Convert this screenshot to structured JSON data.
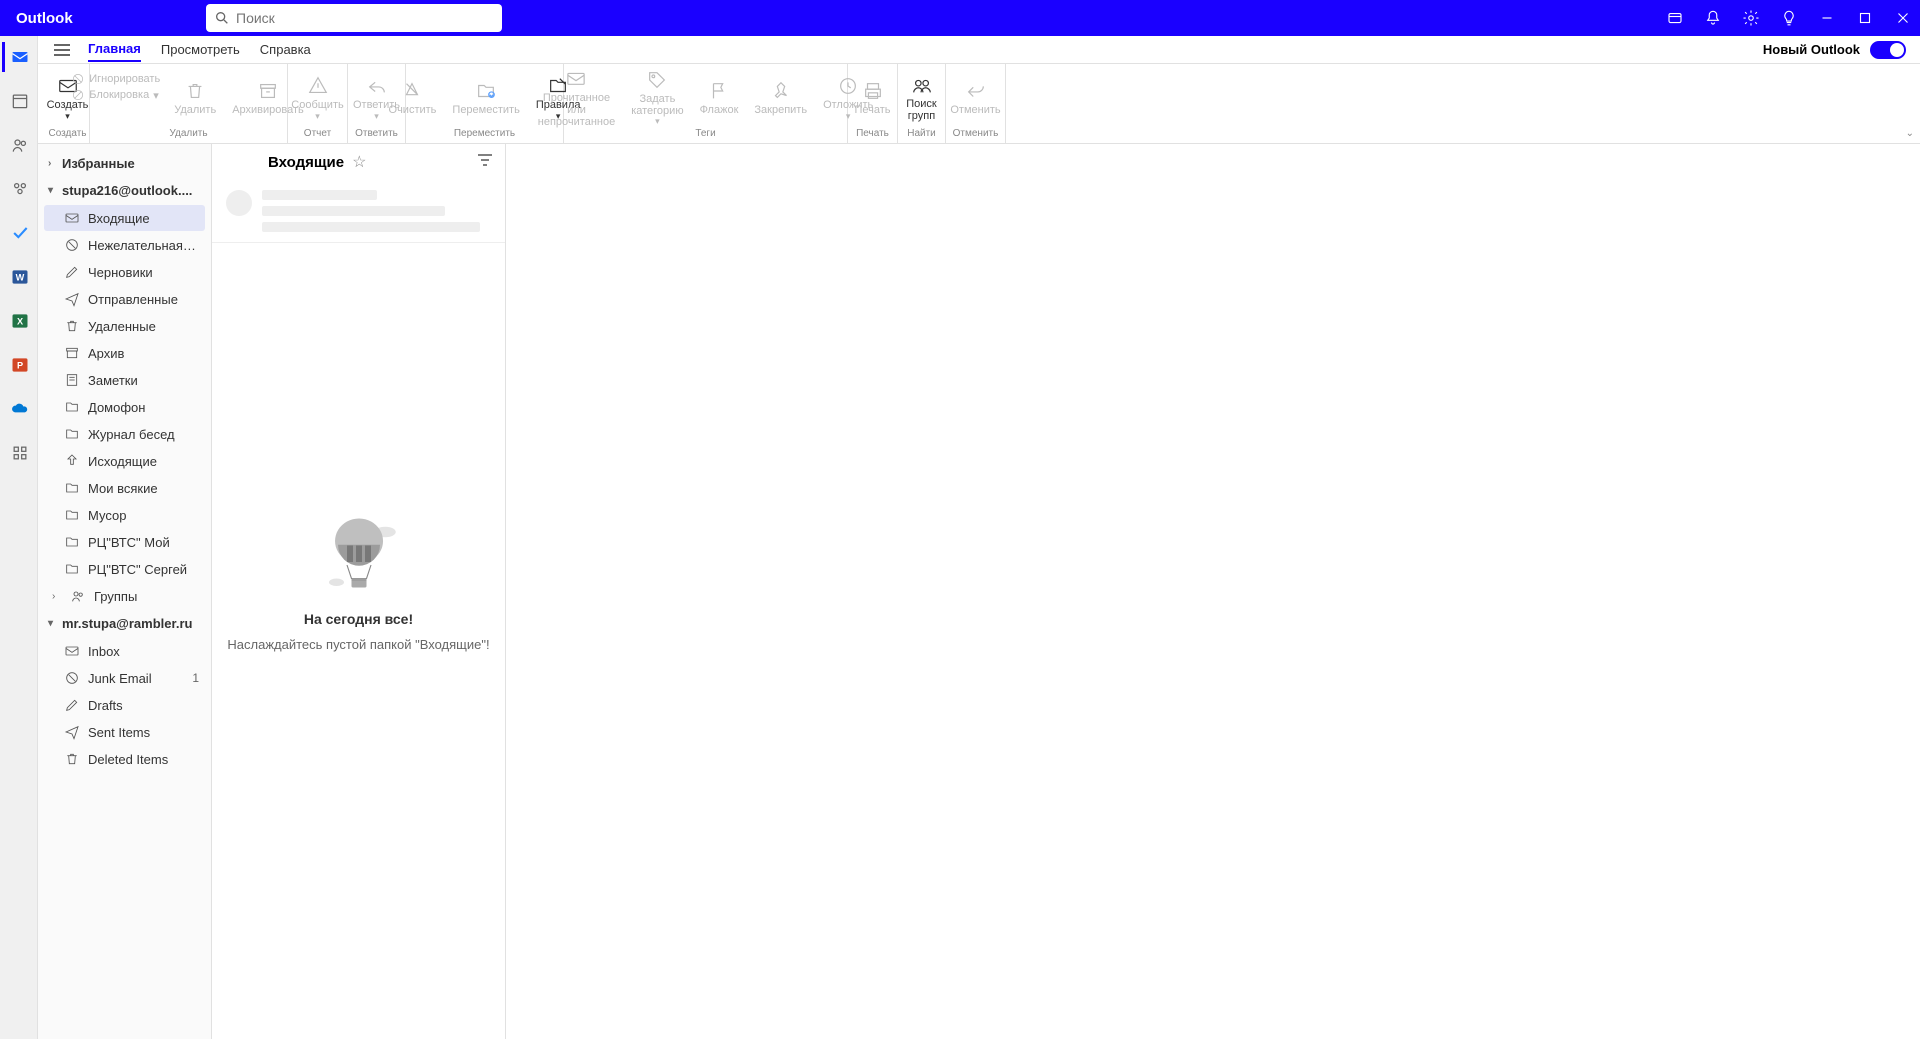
{
  "app_title": "Outlook",
  "search": {
    "placeholder": "Поиск"
  },
  "title_icons": [
    "sync-icon",
    "bell-icon",
    "gear-icon",
    "lightbulb-icon",
    "minimize-icon",
    "maximize-icon",
    "close-icon"
  ],
  "tabs": {
    "home": "Главная",
    "view": "Просмотреть",
    "help": "Справка"
  },
  "new_outlook_label": "Новый Outlook",
  "ribbon": {
    "create": {
      "label": "Создать",
      "group": "Создать"
    },
    "delete_group": "Удалить",
    "ignore": "Игнорировать",
    "block": "Блокировка",
    "delete": "Удалить",
    "archive": "Архивировать",
    "report_group": "Отчет",
    "report": "Сообщить",
    "reply_group": "Ответить",
    "reply": "Ответить",
    "move_group": "Переместить",
    "cleanup": "Очистить",
    "move": "Переместить",
    "rules": "Правила",
    "tags_group": "Теги",
    "readunread": "Прочитанное или непрочитанное",
    "category": "Задать категорию",
    "flag": "Флажок",
    "pin": "Закрепить",
    "snooze": "Отложить",
    "print_group": "Печать",
    "print": "Печать",
    "find_group": "Найти",
    "findgroups": "Поиск групп",
    "undo_group": "Отменить",
    "undo": "Отменить"
  },
  "tree": {
    "favorites": "Избранные",
    "accounts": [
      {
        "name": "stupa216@outlook....",
        "folders": [
          {
            "icon": "inbox",
            "label": "Входящие",
            "active": true
          },
          {
            "icon": "junk",
            "label": "Нежелательная по..."
          },
          {
            "icon": "drafts",
            "label": "Черновики"
          },
          {
            "icon": "sent",
            "label": "Отправленные"
          },
          {
            "icon": "deleted",
            "label": "Удаленные"
          },
          {
            "icon": "archive",
            "label": "Архив"
          },
          {
            "icon": "notes",
            "label": "Заметки"
          },
          {
            "icon": "folder",
            "label": "Домофон"
          },
          {
            "icon": "folder",
            "label": "Журнал бесед"
          },
          {
            "icon": "outbox",
            "label": "Исходящие"
          },
          {
            "icon": "folder",
            "label": "Мои всякие"
          },
          {
            "icon": "folder",
            "label": "Мусор"
          },
          {
            "icon": "folder",
            "label": "РЦ\"ВТС\" Мой"
          },
          {
            "icon": "folder",
            "label": "РЦ\"ВТС\" Сергей"
          },
          {
            "icon": "groups",
            "label": "Группы",
            "caret": true
          }
        ]
      },
      {
        "name": "mr.stupa@rambler.ru",
        "folders": [
          {
            "icon": "inbox",
            "label": "Inbox"
          },
          {
            "icon": "junk",
            "label": "Junk Email",
            "count": "1"
          },
          {
            "icon": "drafts",
            "label": "Drafts"
          },
          {
            "icon": "sent",
            "label": "Sent Items"
          },
          {
            "icon": "deleted",
            "label": "Deleted Items"
          }
        ]
      }
    ]
  },
  "msgcol": {
    "title": "Входящие",
    "empty_title": "На сегодня все!",
    "empty_sub": "Наслаждайтесь пустой папкой \"Входящие\"!"
  }
}
